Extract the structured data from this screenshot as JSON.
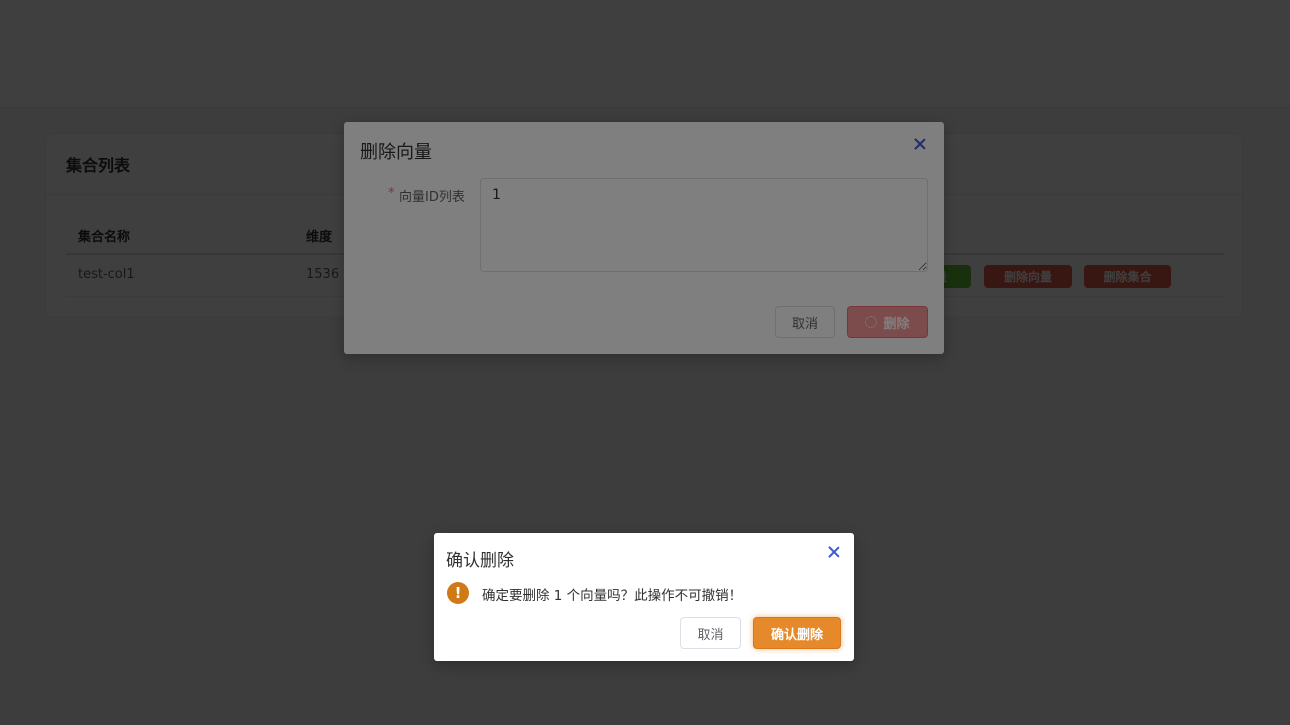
{
  "card": {
    "title": "集合列表",
    "columns": [
      "集合名称",
      "维度"
    ],
    "rows": [
      {
        "name": "test-col1",
        "dimension": "1536",
        "actions": [
          {
            "label": "量",
            "color": "#67c23a"
          },
          {
            "label": "删除向量",
            "color": "#e05a4a"
          },
          {
            "label": "删除集合",
            "color": "#e05a4a"
          }
        ]
      }
    ]
  },
  "delete_dialog": {
    "title": "删除向量",
    "field_label": "向量ID列表",
    "required_mark": "*",
    "field_value": "1",
    "cancel_label": "取消",
    "delete_label": "删除"
  },
  "confirm_dialog": {
    "title": "确认删除",
    "warning_glyph": "!",
    "message": "确定要删除 1 个向量吗？此操作不可撤销！",
    "cancel_label": "取消",
    "confirm_label": "确认删除"
  },
  "colors": {
    "danger": "#f56c6c",
    "warning": "#e6892a",
    "success": "#67c23a",
    "close_icon": "#3a5bd6"
  }
}
